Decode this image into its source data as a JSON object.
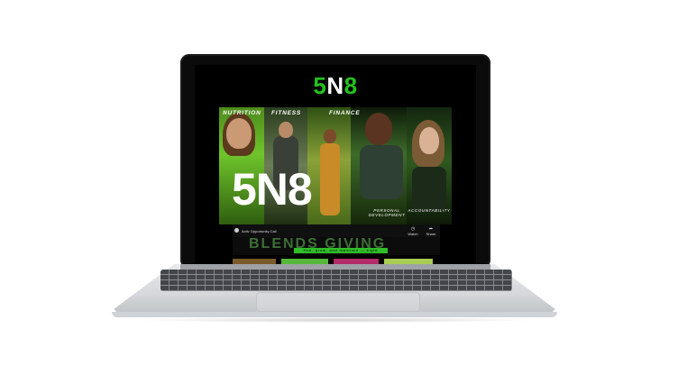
{
  "site_logo": {
    "part1": "5",
    "part2": "N",
    "part3": "8"
  },
  "hero": {
    "categories": [
      "NUTRITION",
      "FITNESS",
      "FINANCE"
    ],
    "subcategories": [
      "PERSONAL DEVELOPMENT",
      "ACCOUNTABILITY"
    ],
    "big_logo": "5N8"
  },
  "video": {
    "title": "Activ Opportunity Call",
    "actions": [
      "Watch later",
      "Share"
    ]
  },
  "banner": {
    "headline": "BLENDS GIVING",
    "strip": "five, grow, and maintain — eight"
  },
  "colors": {
    "brand_green": "#22c31b",
    "screen_bg": "#000000",
    "laptop_silver": "#d5d7da"
  }
}
